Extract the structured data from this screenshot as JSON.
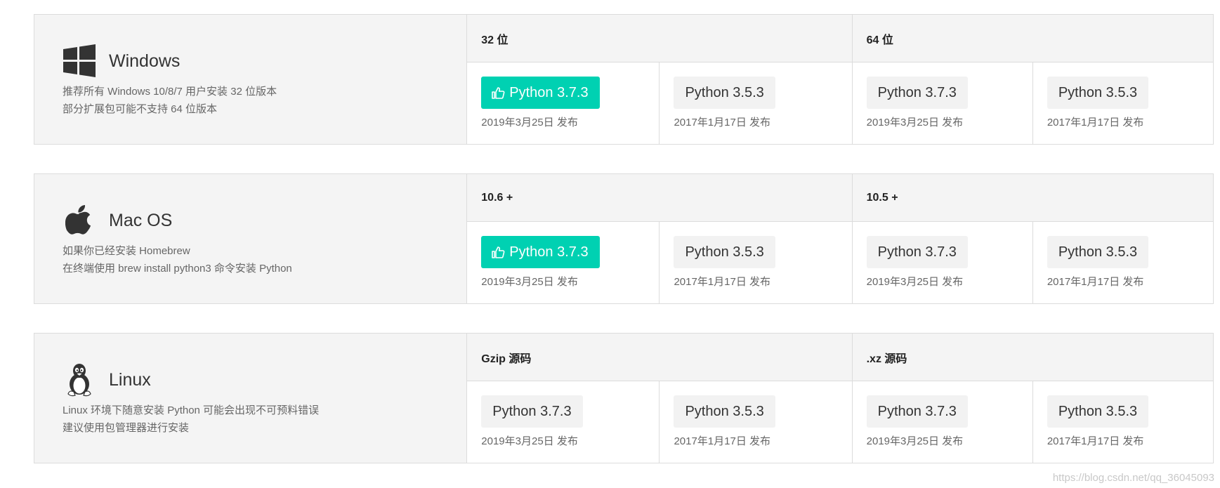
{
  "platforms": [
    {
      "name": "Windows",
      "icon": "windows-logo-icon",
      "desc": [
        "推荐所有 Windows 10/8/7 用户安装 32 位版本",
        "部分扩展包可能不支持 64 位版本"
      ],
      "groups": [
        {
          "label": "32 位",
          "downloads": [
            {
              "label": "Python 3.7.3",
              "date": "2019年3月25日 发布",
              "recommended": true
            },
            {
              "label": "Python 3.5.3",
              "date": "2017年1月17日 发布",
              "recommended": false
            }
          ]
        },
        {
          "label": "64 位",
          "downloads": [
            {
              "label": "Python 3.7.3",
              "date": "2019年3月25日 发布",
              "recommended": false
            },
            {
              "label": "Python 3.5.3",
              "date": "2017年1月17日 发布",
              "recommended": false
            }
          ]
        }
      ]
    },
    {
      "name": "Mac OS",
      "icon": "apple-logo-icon",
      "desc": [
        "如果你已经安装 Homebrew",
        "在终端使用 brew install python3 命令安装 Python"
      ],
      "groups": [
        {
          "label": "10.6 +",
          "downloads": [
            {
              "label": "Python 3.7.3",
              "date": "2019年3月25日 发布",
              "recommended": true
            },
            {
              "label": "Python 3.5.3",
              "date": "2017年1月17日 发布",
              "recommended": false
            }
          ]
        },
        {
          "label": "10.5 +",
          "downloads": [
            {
              "label": "Python 3.7.3",
              "date": "2019年3月25日 发布",
              "recommended": false
            },
            {
              "label": "Python 3.5.3",
              "date": "2017年1月17日 发布",
              "recommended": false
            }
          ]
        }
      ]
    },
    {
      "name": "Linux",
      "icon": "tux-penguin-icon",
      "desc": [
        "Linux 环境下随意安装 Python 可能会出现不可预料错误",
        "建议使用包管理器进行安装"
      ],
      "groups": [
        {
          "label": "Gzip 源码",
          "downloads": [
            {
              "label": "Python 3.7.3",
              "date": "2019年3月25日 发布",
              "recommended": false
            },
            {
              "label": "Python 3.5.3",
              "date": "2017年1月17日 发布",
              "recommended": false
            }
          ]
        },
        {
          "label": ".xz 源码",
          "downloads": [
            {
              "label": "Python 3.7.3",
              "date": "2019年3月25日 发布",
              "recommended": false
            },
            {
              "label": "Python 3.5.3",
              "date": "2017年1月17日 发布",
              "recommended": false
            }
          ]
        }
      ]
    }
  ],
  "watermark": "https://blog.csdn.net/qq_36045093",
  "colors": {
    "accent": "#00d1b2",
    "panel": "#f4f4f4",
    "border": "#dcdcdc"
  }
}
